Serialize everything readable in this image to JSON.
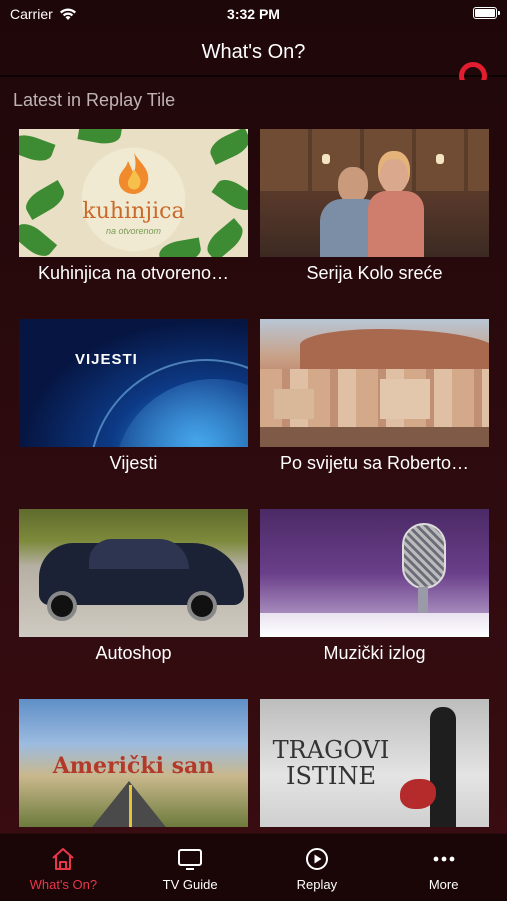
{
  "status_bar": {
    "carrier": "Carrier",
    "time": "3:32 PM"
  },
  "nav": {
    "title": "What's On?"
  },
  "section": {
    "title": "Latest in Replay Tile"
  },
  "tiles": [
    {
      "title": "Kuhinjica na otvoreno…",
      "thumb_text": "kuhinjica",
      "thumb_subtext": "na otvorenom"
    },
    {
      "title": "Serija Kolo sreće"
    },
    {
      "title": "Vijesti",
      "thumb_text": "VIJESTI"
    },
    {
      "title": "Po svijetu sa Roberto…"
    },
    {
      "title": "Autoshop"
    },
    {
      "title": "Muzički izlog"
    },
    {
      "title": "",
      "thumb_text": "Američki san"
    },
    {
      "title": "",
      "thumb_text": "TRAGOVI ISTINE"
    }
  ],
  "tab_bar": {
    "items": [
      {
        "label": "What's On?",
        "icon": "home-icon",
        "active": true
      },
      {
        "label": "TV Guide",
        "icon": "tv-icon",
        "active": false
      },
      {
        "label": "Replay",
        "icon": "replay-icon",
        "active": false
      },
      {
        "label": "More",
        "icon": "more-icon",
        "active": false
      }
    ]
  },
  "colors": {
    "accent": "#e8374b",
    "background": "#2a0a0d",
    "tab_bar": "#1a0507",
    "brand_ring": "#e11d2f"
  }
}
